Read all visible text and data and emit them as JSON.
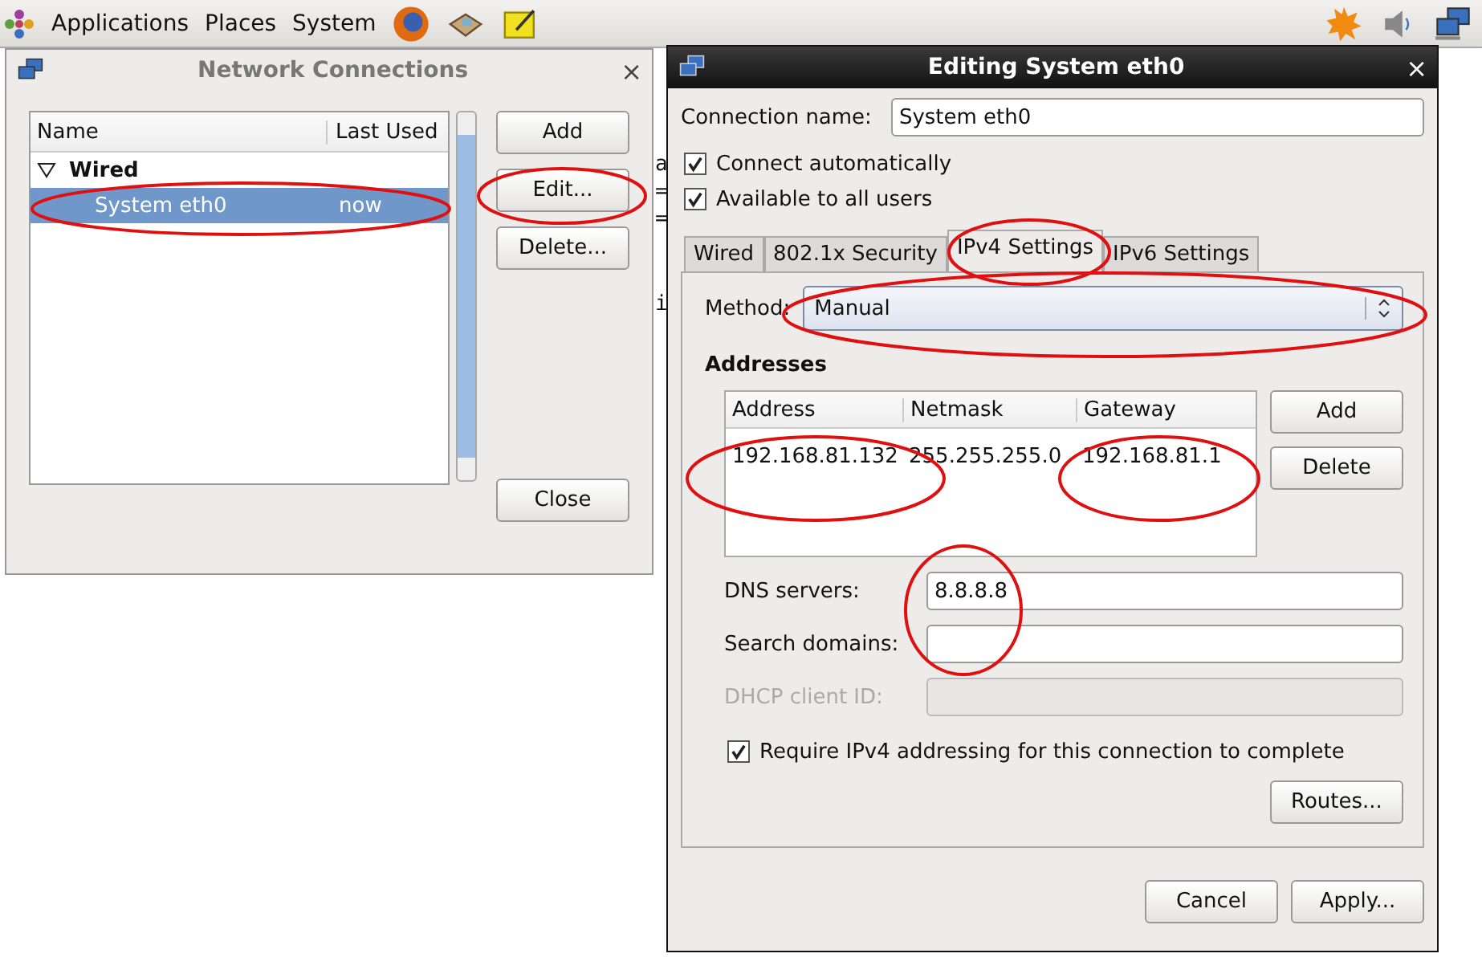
{
  "panel": {
    "menus": [
      "Applications",
      "Places",
      "System"
    ]
  },
  "background_fragments": [
    "a",
    "=",
    "=",
    "i"
  ],
  "connections_window": {
    "title": "Network Connections",
    "close": "×",
    "columns": [
      "Name",
      "Last Used"
    ],
    "groups": [
      {
        "label": "Wired",
        "expanded": true,
        "children": [
          {
            "name": "System eth0",
            "last_used": "now",
            "selected": true
          }
        ]
      }
    ],
    "buttons": [
      "Add",
      "Edit...",
      "Delete..."
    ],
    "close_button": "Close"
  },
  "edit_window": {
    "title": "Editing System eth0",
    "close": "×",
    "connection_name_label": "Connection name:",
    "connection_name": "System eth0",
    "checkboxes": [
      {
        "label": "Connect automatically",
        "checked": true
      },
      {
        "label": "Available to all users",
        "checked": true
      }
    ],
    "tabs": [
      {
        "label": "Wired",
        "selected": false
      },
      {
        "label": "802.1x Security",
        "selected": false
      },
      {
        "label": "IPv4 Settings",
        "selected": true
      },
      {
        "label": "IPv6 Settings",
        "selected": false
      }
    ],
    "method_label": "Method:",
    "method": "Manual",
    "addresses_heading": "Addresses",
    "address_columns": [
      "Address",
      "Netmask",
      "Gateway"
    ],
    "address_rows": [
      [
        "192.168.81.132",
        "255.255.255.0",
        "192.168.81.1"
      ]
    ],
    "address_buttons": [
      "Add",
      "Delete"
    ],
    "fields": [
      {
        "label": "DNS servers:",
        "value": "8.8.8.8",
        "disabled": false
      },
      {
        "label": "Search domains:",
        "disabled": false
      },
      {
        "label": "DHCP client ID:",
        "disabled": true
      }
    ],
    "require": {
      "label": "Require IPv4 addressing for this connection to complete",
      "checked": true
    },
    "routes_button": "Routes...",
    "footer_buttons": [
      "Cancel",
      "Apply..."
    ]
  }
}
